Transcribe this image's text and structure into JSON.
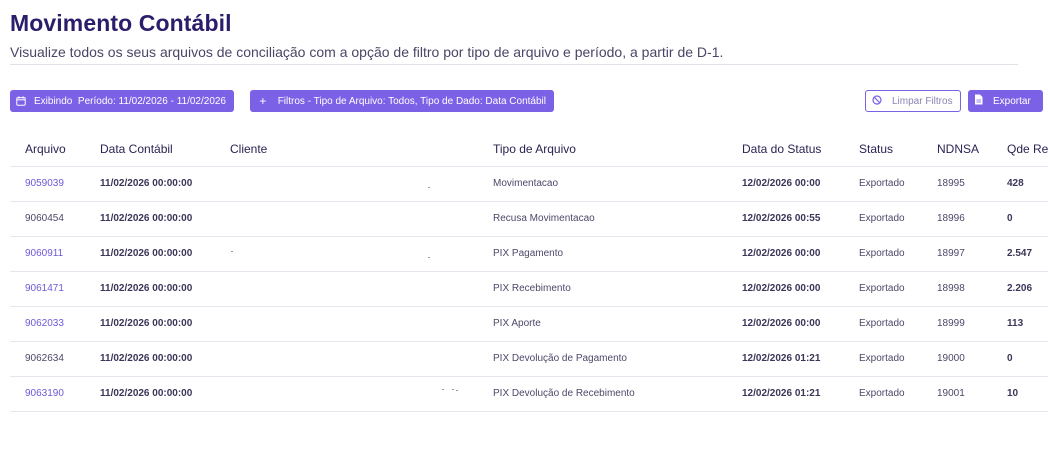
{
  "page": {
    "title": "Movimento Contábil",
    "subtitle": "Visualize todos os seus arquivos de conciliação com a opção de filtro por tipo de arquivo e período, a partir de D-1."
  },
  "toolbar": {
    "period_label": "Exibindo  Período: 11/02/2026 - 11/02/2026",
    "filter_label": "Filtros - Tipo de Arquivo: Todos, Tipo de Dado: Data Contábil",
    "clear_label": "Limpar Filtros",
    "export_label": "Exportar",
    "accent_color": "#7b61e6"
  },
  "table": {
    "headers": {
      "arquivo": "Arquivo",
      "data_contabil": "Data Contábil",
      "cliente": "Cliente",
      "tipo_arquivo": "Tipo de Arquivo",
      "data_status": "Data do Status",
      "status": "Status",
      "ndnsa": "NDNSA",
      "qde": "Qde Re"
    },
    "rows": [
      {
        "arquivo": "9059039",
        "linked": true,
        "data_contabil": "11/02/2026 00:00:00",
        "cliente": "",
        "tipo_arquivo": "Movimentacao",
        "data_status": "12/02/2026 00:00",
        "status": "Exportado",
        "ndnsa": "18995",
        "qde": "428"
      },
      {
        "arquivo": "9060454",
        "linked": false,
        "data_contabil": "11/02/2026 00:00:00",
        "cliente": "",
        "tipo_arquivo": "Recusa Movimentacao",
        "data_status": "12/02/2026 00:55",
        "status": "Exportado",
        "ndnsa": "18996",
        "qde": "0"
      },
      {
        "arquivo": "9060911",
        "linked": true,
        "data_contabil": "11/02/2026 00:00:00",
        "cliente": "",
        "tipo_arquivo": "PIX Pagamento",
        "data_status": "12/02/2026 00:00",
        "status": "Exportado",
        "ndnsa": "18997",
        "qde": "2.547"
      },
      {
        "arquivo": "9061471",
        "linked": true,
        "data_contabil": "11/02/2026 00:00:00",
        "cliente": "",
        "tipo_arquivo": "PIX Recebimento",
        "data_status": "12/02/2026 00:00",
        "status": "Exportado",
        "ndnsa": "18998",
        "qde": "2.206"
      },
      {
        "arquivo": "9062033",
        "linked": true,
        "data_contabil": "11/02/2026 00:00:00",
        "cliente": "",
        "tipo_arquivo": "PIX Aporte",
        "data_status": "12/02/2026 00:00",
        "status": "Exportado",
        "ndnsa": "18999",
        "qde": "113"
      },
      {
        "arquivo": "9062634",
        "linked": false,
        "data_contabil": "11/02/2026 00:00:00",
        "cliente": "",
        "tipo_arquivo": "PIX Devolução de Pagamento",
        "data_status": "12/02/2026 01:21",
        "status": "Exportado",
        "ndnsa": "19000",
        "qde": "0"
      },
      {
        "arquivo": "9063190",
        "linked": true,
        "data_contabil": "11/02/2026 00:00:00",
        "cliente": "",
        "tipo_arquivo": "PIX Devolução de Recebimento",
        "data_status": "12/02/2026 01:21",
        "status": "Exportado",
        "ndnsa": "19001",
        "qde": "10"
      }
    ]
  },
  "icons": {
    "calendar": "calendar-icon",
    "plus": "plus-icon",
    "clear": "ban-icon",
    "export": "document-icon"
  }
}
